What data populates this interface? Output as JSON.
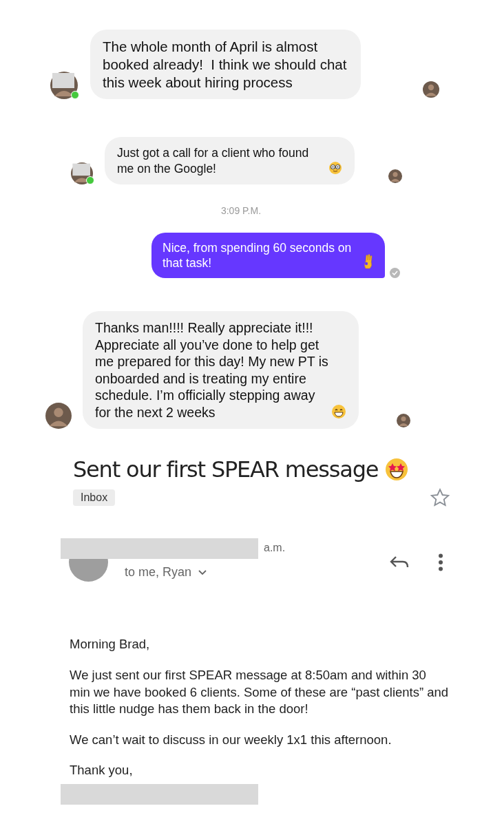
{
  "chat": [
    {
      "kind": "received",
      "text": "The whole month of April is almost booked already!  I think we should chat this week about hiring process",
      "online": true,
      "redacted": true
    },
    {
      "kind": "received",
      "text": "Just got a call for a client who found me on the Google!",
      "online": true,
      "redacted": true
    },
    {
      "kind": "time",
      "text": "3:09 P.M."
    },
    {
      "kind": "sent",
      "text": "Nice, from spending 60 seconds on that task!",
      "seen": true
    },
    {
      "kind": "received",
      "text": "Thanks man!!!! Really appreciate it!!! Appreciate all you’ve done to help get me prepared for this day! My new PT is onboarded and is treating my entire schedule. I’m officially stepping away for the next 2 weeks",
      "online": false,
      "redacted": false
    }
  ],
  "email": {
    "subject": "Sent our first SPEAR message",
    "label": "Inbox",
    "starred": false,
    "time": "a.m.",
    "recipients": "to me, Ryan",
    "body": [
      "Morning Brad,",
      "We just sent our first SPEAR message at 8:50am and within 30 min we have booked 6 clients. Some of these are “past clients” and this little nudge has them back in the door!",
      "We can’t wait to discuss in our weekly 1x1 this afternoon.",
      "Thank you,"
    ]
  }
}
